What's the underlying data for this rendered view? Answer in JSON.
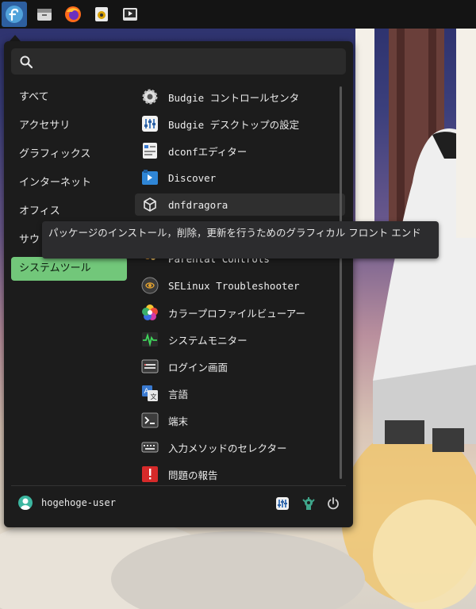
{
  "panel": {
    "items": [
      {
        "icon": "fedora-logo-icon"
      },
      {
        "icon": "file-manager-icon"
      },
      {
        "icon": "firefox-icon"
      },
      {
        "icon": "rhythmbox-icon"
      },
      {
        "icon": "video-player-icon"
      }
    ]
  },
  "menu": {
    "search": {
      "value": "",
      "placeholder": ""
    },
    "categories": [
      {
        "label": "すべて"
      },
      {
        "label": "アクセサリ"
      },
      {
        "label": "グラフィックス"
      },
      {
        "label": "インターネット"
      },
      {
        "label": "オフィス"
      },
      {
        "label": "サウ"
      },
      {
        "label": "システムツール",
        "active": true
      }
    ],
    "apps": [
      {
        "label": "Budgie コントロールセンタ",
        "icon": "gear-icon"
      },
      {
        "label": "Budgie デスクトップの設定",
        "icon": "desktop-settings-icon"
      },
      {
        "label": "dconfエディター",
        "icon": "dconf-editor-icon"
      },
      {
        "label": "Discover",
        "icon": "discover-icon"
      },
      {
        "label": "dnfdragora",
        "icon": "package-icon"
      },
      {
        "label": "Parental Controls",
        "icon": "parental-controls-icon"
      },
      {
        "label": "SELinux Troubleshooter",
        "icon": "selinux-icon"
      },
      {
        "label": "カラープロファイルビューアー",
        "icon": "color-profile-icon"
      },
      {
        "label": "システムモニター",
        "icon": "system-monitor-icon"
      },
      {
        "label": "ログイン画面",
        "icon": "login-screen-icon"
      },
      {
        "label": "言語",
        "icon": "language-icon"
      },
      {
        "label": "端末",
        "icon": "terminal-icon"
      },
      {
        "label": "入力メソッドのセレクター",
        "icon": "input-method-icon"
      },
      {
        "label": "問題の報告",
        "icon": "problem-report-icon"
      }
    ],
    "tooltip": "パッケージのインストール，削除，更新を行うためのグラフィカル フロント エンド",
    "footer": {
      "username": "hogehoge-user",
      "buttons": [
        {
          "icon": "settings-icon"
        },
        {
          "icon": "lock-icon"
        },
        {
          "icon": "power-icon"
        }
      ]
    }
  },
  "colors": {
    "accent_active_category": "#72c77a",
    "menu_background": "#1c1c1c",
    "panel_background": "#141414"
  }
}
